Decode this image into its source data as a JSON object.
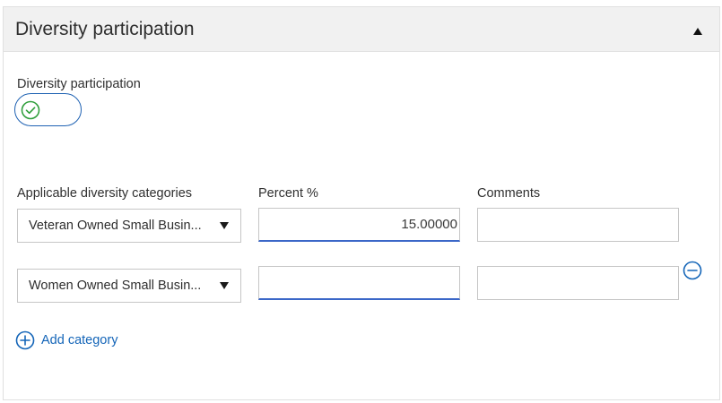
{
  "panel": {
    "title": "Diversity participation",
    "collapse_icon": "triangle-up-icon"
  },
  "toggle": {
    "label": "Diversity participation",
    "state": "on",
    "icon": "check-circle-icon",
    "color": "#2e9e3a"
  },
  "columns": {
    "category": "Applicable diversity categories",
    "percent": "Percent %",
    "comments": "Comments"
  },
  "rows": [
    {
      "category": "Veteran Owned Small Busin...",
      "percent": "15.00000",
      "comments": ""
    },
    {
      "category": "Women Owned Small Busin...",
      "percent": "",
      "comments": "",
      "removable": true
    }
  ],
  "add_category": {
    "label": "Add category",
    "icon": "plus-circle-icon"
  },
  "colors": {
    "accent": "#1465b8",
    "success": "#2e9e3a",
    "header_bg": "#f1f1f1"
  }
}
